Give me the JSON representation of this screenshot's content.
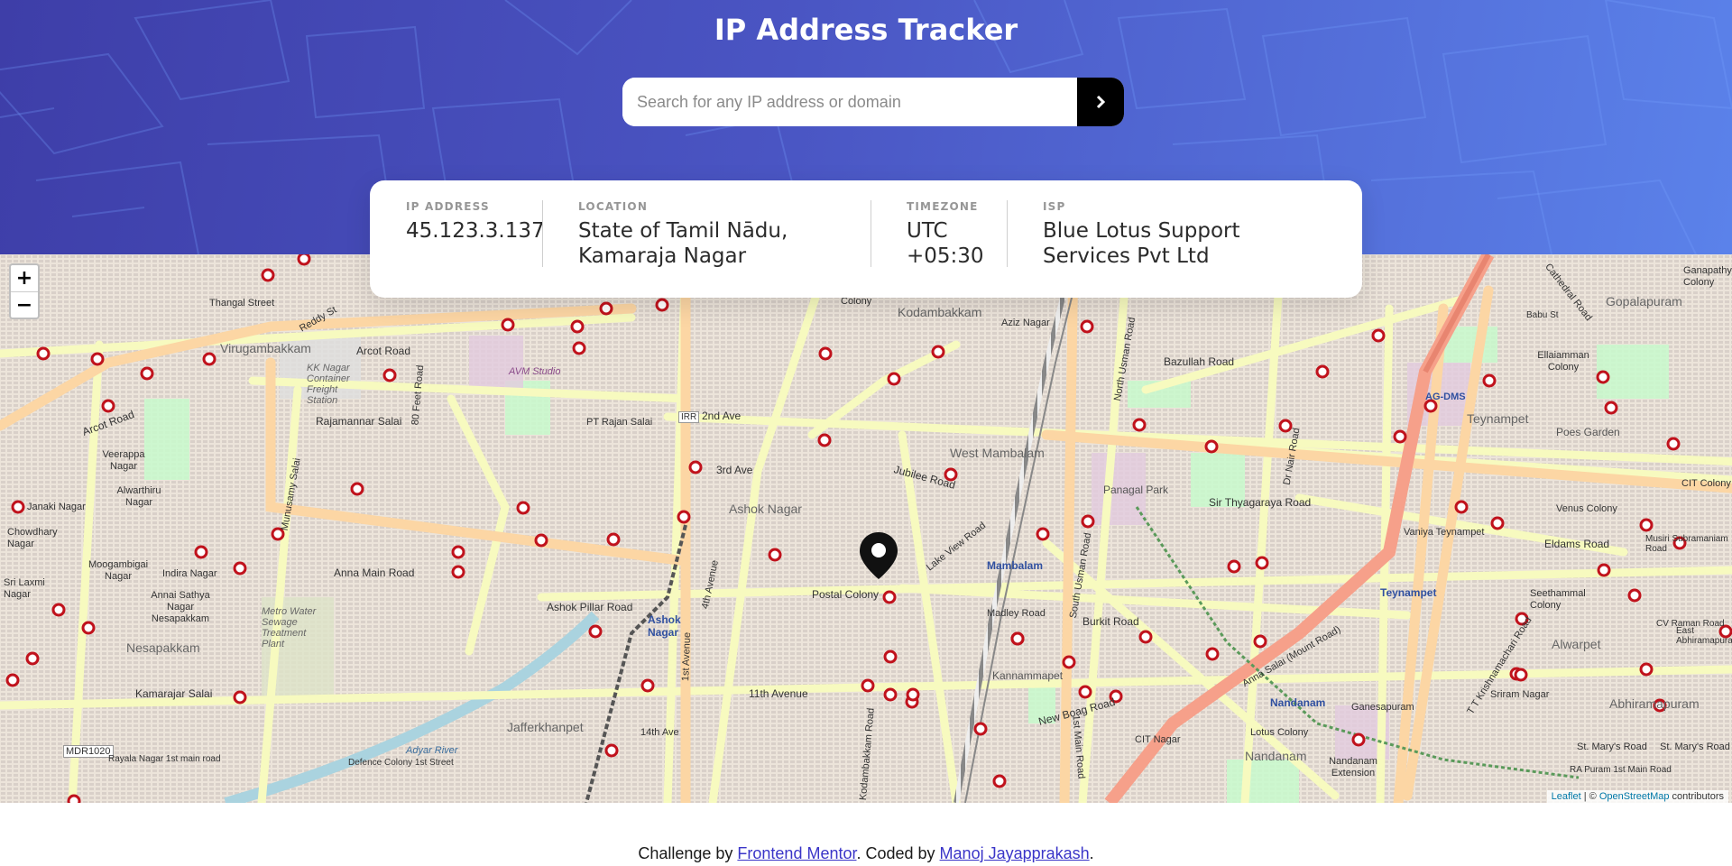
{
  "header": {
    "title": "IP Address Tracker",
    "search": {
      "placeholder": "Search for any IP address or domain",
      "value": ""
    },
    "submit_icon": "chevron-right-icon"
  },
  "info": {
    "ip": {
      "label": "IP ADDRESS",
      "value": "45.123.3.137"
    },
    "location": {
      "label": "LOCATION",
      "line1": "State of Tamil Nādu,",
      "line2": "Kamaraja Nagar"
    },
    "timezone": {
      "label": "TIMEZONE",
      "line1": "UTC",
      "line2": "+05:30"
    },
    "isp": {
      "label": "ISP",
      "line1": "Blue Lotus Support",
      "line2": "Services Pvt Ltd"
    }
  },
  "map": {
    "zoom_in": "+",
    "zoom_out": "−",
    "marker_icon": "location-pin-icon",
    "attribution": {
      "leaflet": "Leaflet",
      "separator": " | © ",
      "osm": "OpenStreetMap",
      "suffix": " contributors"
    },
    "labels": {
      "virugambakkam": "Virugambakkam",
      "kodambakkam": "Kodambakkam",
      "west_mambalam": "West Mambalam",
      "ashok_nagar": "Ashok Nagar",
      "mambalam": "Mambalam",
      "teynampet": "Teynampet",
      "teynampet_stn": "Teynampet",
      "nesapakkam": "Nesapakkam",
      "jafferkhanpet": "Jafferkhanpet",
      "kannammapet": "Kannammapet",
      "nandanam": "Nandanam",
      "nandanam_stn": "Nandanam",
      "alwarpet": "Alwarpet",
      "abhiramapuram": "Abhiramapuram",
      "gopalapuram": "Gopalapuram",
      "poes_garden": "Poes Garden",
      "panagal_park": "Panagal Park",
      "ashok_nagar_stn": "Ashok Nagar",
      "arcot_road": "Arcot Road",
      "arcot_road2": "Arcot Road",
      "rajamannar_salai": "Rajamannar Salai",
      "anna_main_road": "Anna Main Road",
      "kamarajar_salai": "Kamarajar Salai",
      "postal_colony": "Postal Colony",
      "jubilee_road": "Jubilee Road",
      "burkit_road": "Burkit Road",
      "new_boag_road": "New Boag Road",
      "sir_thyagaraya_road": "Sir Thyagaraya Road",
      "eldams_road": "Eldams Road",
      "11th_avenue": "11th Avenue",
      "bazullah_road": "Bazullah Road",
      "2nd_avenue": "2nd Ave",
      "3rd_avenue": "3rd Ave",
      "ashok_pillar_road": "Ashok Pillar Road",
      "mdr1020": "MDR1020",
      "ag_dms": "AG-DMS",
      "kk_nagar_freight": "KK Nagar Container Freight Station",
      "metro_water": "Metro Water Sewage Treatment Plant",
      "avm_studio": "AVM Studio",
      "vaniya_teynampet": "Vaniya Teynampet",
      "lotus_colony": "Lotus Colony",
      "venus_colony": "Venus Colony",
      "seethammal_colony": "Seethammal Colony",
      "irr": "IRR",
      "chowdhary_nagar": "Chowdhary Nagar",
      "veerappa_nagar": "Veerappa Nagar",
      "alwarthiru_nagar": "Alwarthiru Nagar",
      "janaki_nagar": "Janaki Nagar",
      "indira_nagar": "Indira Nagar",
      "sri_laxmi_nagar": "Sri Laxmi Nagar",
      "moogambigai_nagar": "Moogambigai Nagar",
      "annai_sathya_nagar": "Annai Sathya Nagar Nesapakkam",
      "ellaiamman_colony": "Ellaiamman Colony",
      "colony_top": "Colony",
      "aziz_nagar": "Aziz Nagar",
      "ganapathy_colony": "Ganapathy Colony",
      "srirram_nagar": "Sriram Nagar",
      "cit_colony": "CIT Colony",
      "cit_nagar": "CIT Nagar",
      "nandanam_ext": "Nandanam Extension",
      "ganesapuram": "Ganesapuram",
      "madley_road": "Madley Road",
      "1st_main_road": "1st Main Road",
      "south_usman_road": "South Usman Road",
      "north_usman_road": "North Usman Road",
      "lake_view_road": "Lake View Road",
      "anna_salai": "Anna Salai (Mount Road)",
      "ttk_road": "T T Krishnamachari Road",
      "cathedral_road": "Cathedral Road",
      "dr_nair_road": "Dr Nair Road",
      "4th_avenue": "4th Avenue",
      "1st_avenue": "1st Avenue",
      "munusamy_salai": "Munusamy Salai",
      "kodambakkam_road": "Kodambakkam Road",
      "80_feet_road": "80 Feet Road",
      "reddy_st": "Reddy St",
      "thangal_street": "Thangal Street",
      "pt_rajan_salai": "PT Rajan Salai",
      "defence_colony": "Defence Colony 1st Street",
      "rayala_nagar": "Rayala Nagar 1st main road",
      "adyar_river": "Adyar River",
      "14th_ave": "14th Ave",
      "ra_puram": "RA Puram 1st Main Road",
      "st_marys_road": "St. Mary's Road",
      "st_marys_road2": "St. Mary's Road",
      "cv_raman": "CV Raman Road",
      "musiri": "Musiri Subramaniam Road",
      "east_abhiramapuram": "East Abhiramapuram",
      "babu_st": "Babu St"
    }
  },
  "footer": {
    "prefix": "Challenge by ",
    "challenge_link": "Frontend Mentor",
    "middle": ". Coded by ",
    "author_link": "Manoj Jayapprakash",
    "suffix": "."
  },
  "colors": {
    "header_start": "#3e3ea8",
    "header_end": "#5b82ea",
    "primary_road": "#fcd6a4",
    "secondary_road": "#f7fabf",
    "railway": "#777777",
    "metro_line": "#f28d7a",
    "poi_red": "#c0121c",
    "park": "#c8facc",
    "building": "#d9d0c9",
    "link": "#3a35c8"
  }
}
